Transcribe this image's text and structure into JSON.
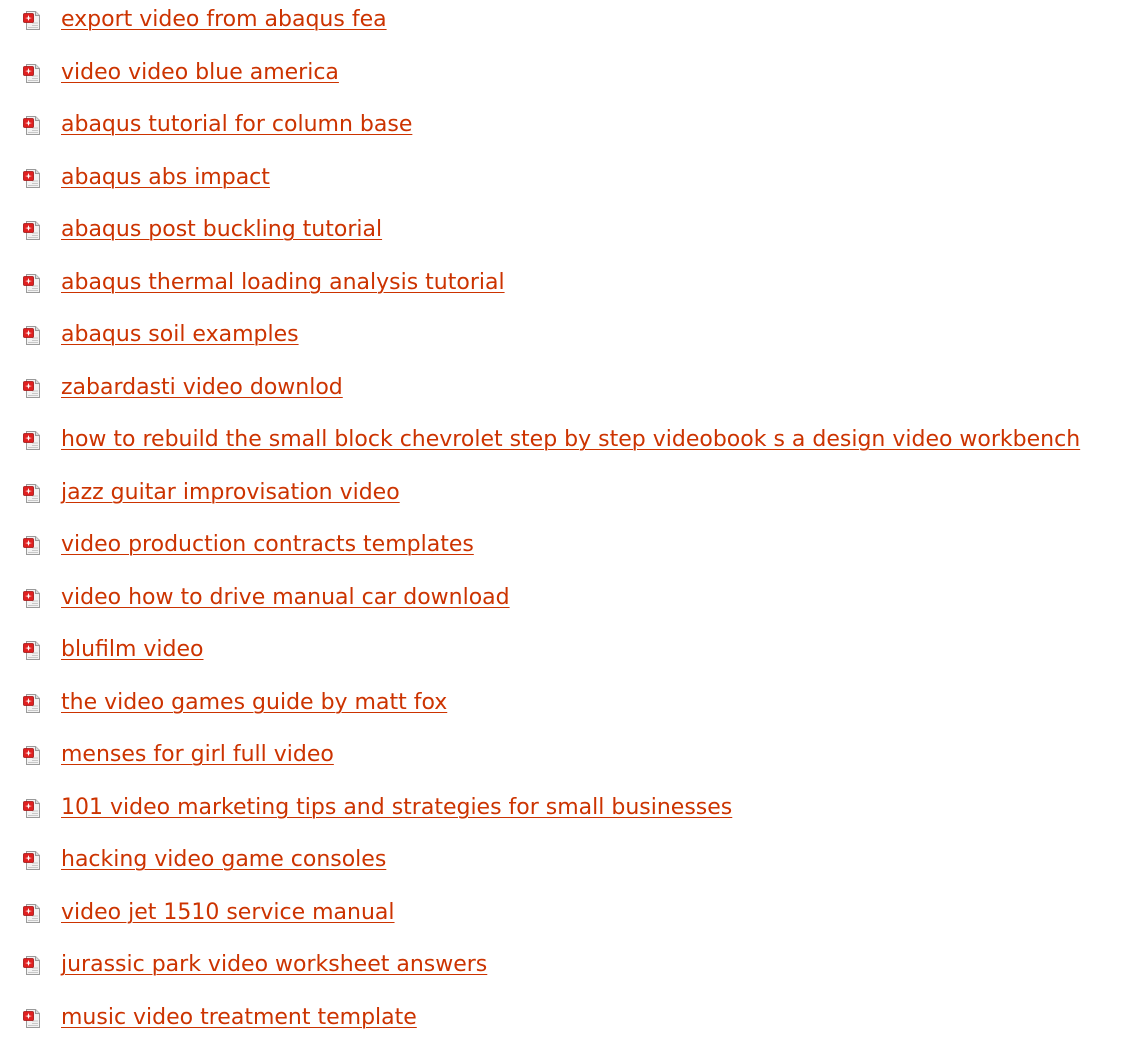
{
  "links": [
    {
      "label": "export video from abaqus fea",
      "icon": "pdf-icon"
    },
    {
      "label": "video video blue america",
      "icon": "pdf-icon"
    },
    {
      "label": "abaqus tutorial for column base",
      "icon": "pdf-icon"
    },
    {
      "label": "abaqus abs impact",
      "icon": "pdf-icon"
    },
    {
      "label": "abaqus post buckling tutorial",
      "icon": "pdf-icon"
    },
    {
      "label": "abaqus thermal loading analysis tutorial",
      "icon": "pdf-icon"
    },
    {
      "label": "abaqus soil examples",
      "icon": "pdf-icon"
    },
    {
      "label": "zabardasti video downlod",
      "icon": "pdf-icon"
    },
    {
      "label": "how to rebuild the small block chevrolet step by step videobook s a design video workbench",
      "icon": "pdf-icon"
    },
    {
      "label": "jazz guitar improvisation video",
      "icon": "pdf-icon"
    },
    {
      "label": "video production contracts templates",
      "icon": "pdf-icon"
    },
    {
      "label": "video how to drive manual car download",
      "icon": "pdf-icon"
    },
    {
      "label": "blufilm video",
      "icon": "pdf-icon"
    },
    {
      "label": "the video games guide by matt fox",
      "icon": "pdf-icon"
    },
    {
      "label": "menses for girl full video",
      "icon": "pdf-icon"
    },
    {
      "label": "101 video marketing tips and strategies for small businesses",
      "icon": "pdf-icon"
    },
    {
      "label": "hacking video game consoles",
      "icon": "pdf-icon"
    },
    {
      "label": "video jet 1510 service manual",
      "icon": "pdf-icon"
    },
    {
      "label": "jurassic park video worksheet answers",
      "icon": "pdf-icon"
    },
    {
      "label": "music video treatment template",
      "icon": "pdf-icon"
    }
  ],
  "colors": {
    "link": "#cc3300",
    "icon_red": "#e02020",
    "icon_paper": "#f2f2f2"
  }
}
